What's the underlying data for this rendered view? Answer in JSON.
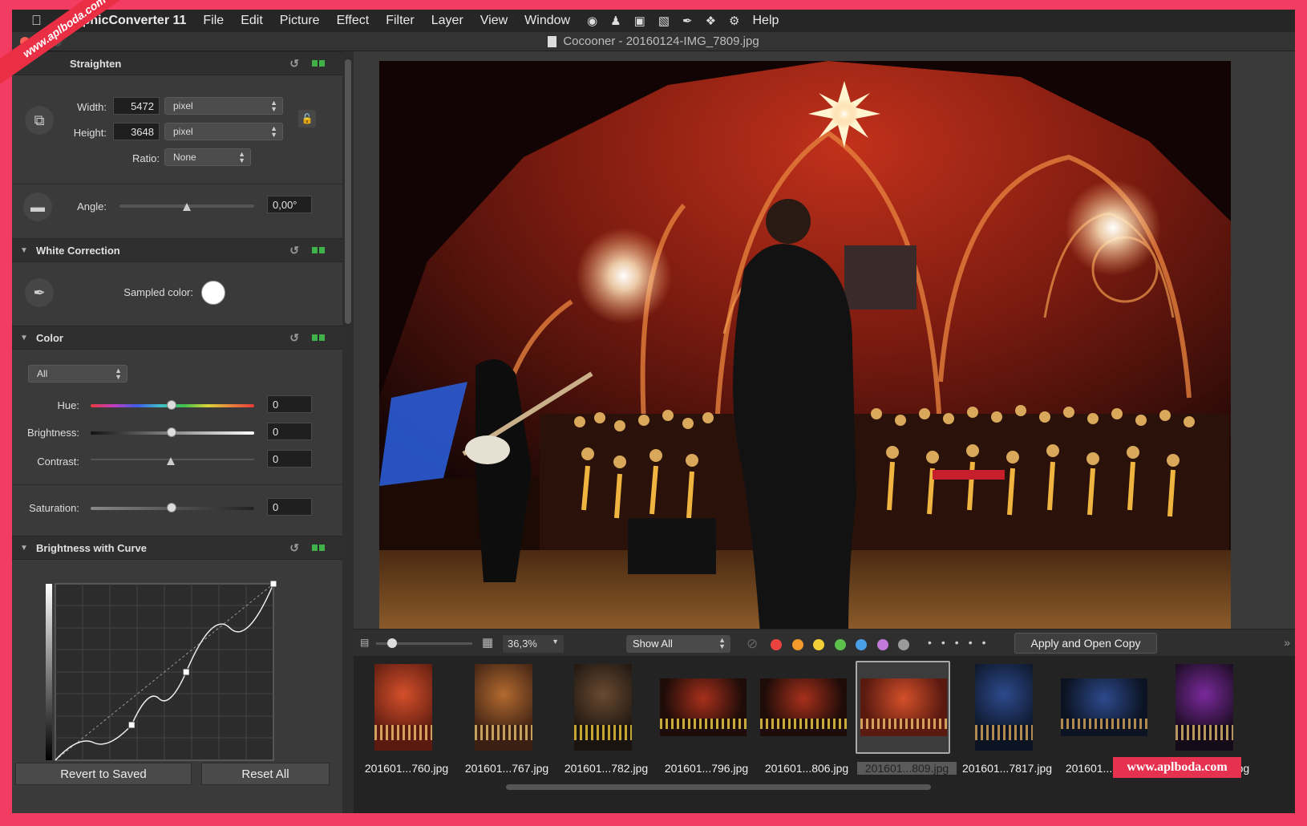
{
  "menubar": {
    "app_name": "GraphicConverter 11",
    "items": [
      "File",
      "Edit",
      "Picture",
      "Effect",
      "Filter",
      "Layer",
      "View",
      "Window",
      "Help"
    ]
  },
  "window": {
    "title": "Cocooner - 20160124-IMG_7809.jpg"
  },
  "panel": {
    "crop": {
      "title": "Straighten",
      "width_label": "Width:",
      "width_value": "5472",
      "width_unit": "pixel",
      "height_label": "Height:",
      "height_value": "3648",
      "height_unit": "pixel",
      "ratio_label": "Ratio:",
      "ratio_value": "None",
      "angle_label": "Angle:",
      "angle_value": "0,00°",
      "angle_level": 0.5
    },
    "white": {
      "title": "White Correction",
      "sampled_label": "Sampled color:",
      "sampled_color": "#ffffff"
    },
    "color": {
      "title": "Color",
      "channel": "All",
      "hue_label": "Hue:",
      "hue_value": "0",
      "brightness_label": "Brightness:",
      "brightness_value": "0",
      "contrast_label": "Contrast:",
      "contrast_value": "0",
      "saturation_label": "Saturation:",
      "saturation_value": "0"
    },
    "curve": {
      "title": "Brightness with Curve",
      "points": [
        [
          0,
          0
        ],
        [
          0.35,
          0.2
        ],
        [
          0.6,
          0.5
        ],
        [
          1,
          1
        ]
      ]
    },
    "revert_label": "Revert to Saved",
    "reset_label": "Reset All"
  },
  "toolbar": {
    "zoom": "36,3%",
    "filter": "Show All",
    "label_colors": [
      "#e8433f",
      "#f39a2c",
      "#f2cf36",
      "#5cc14b",
      "#4a9ee6",
      "#c27ad9",
      "#9a9a9a"
    ],
    "apply_label": "Apply and Open Copy"
  },
  "thumbnails": [
    {
      "caption": "201601...760.jpg",
      "palette": "red"
    },
    {
      "caption": "201601...767.jpg",
      "palette": "warm"
    },
    {
      "caption": "201601...782.jpg",
      "palette": "yellow"
    },
    {
      "caption": "201601...796.jpg",
      "palette": "stage"
    },
    {
      "caption": "201601...806.jpg",
      "palette": "stage"
    },
    {
      "caption": "201601...809.jpg",
      "palette": "red",
      "selected": true
    },
    {
      "caption": "201601...7817.jpg",
      "palette": "blue"
    },
    {
      "caption": "201601...820.jpg",
      "palette": "blue"
    },
    {
      "caption": "201601...822.jpg",
      "palette": "purple"
    }
  ],
  "watermarks": {
    "top_left": "www.aplboda.com",
    "bottom_right": "www.aplboda.com"
  }
}
